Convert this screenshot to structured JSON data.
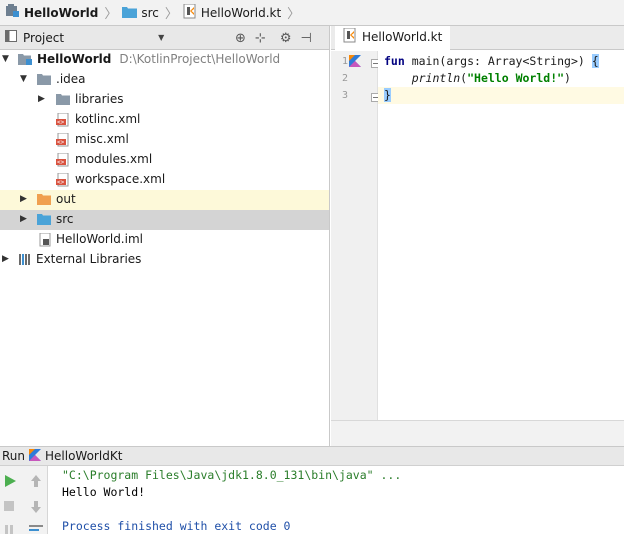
{
  "navbar": {
    "crumbs": [
      {
        "label": "HelloWorld",
        "icon": "project-module-icon"
      },
      {
        "label": "src",
        "icon": "source-folder-icon"
      },
      {
        "label": "HelloWorld.kt",
        "icon": "kotlin-file-icon"
      }
    ]
  },
  "project_pane": {
    "title": "Project",
    "toolbar_icons": [
      "target-icon",
      "collapse-all-icon",
      "gear-icon",
      "hide-panel-icon"
    ],
    "tree": [
      {
        "label": "HelloWorld",
        "path": "D:\\KotlinProject\\HelloWorld",
        "level": 0,
        "expanded": true,
        "icon": "module-folder-icon"
      },
      {
        "label": ".idea",
        "level": 1,
        "expanded": true,
        "icon": "folder-icon"
      },
      {
        "label": "libraries",
        "level": 2,
        "expanded": false,
        "icon": "folder-icon"
      },
      {
        "label": "kotlinc.xml",
        "level": 2,
        "icon": "xml-file-icon"
      },
      {
        "label": "misc.xml",
        "level": 2,
        "icon": "xml-file-icon"
      },
      {
        "label": "modules.xml",
        "level": 2,
        "icon": "xml-file-icon"
      },
      {
        "label": "workspace.xml",
        "level": 2,
        "icon": "xml-file-icon"
      },
      {
        "label": "out",
        "level": 1,
        "expanded": false,
        "icon": "excluded-folder-icon",
        "highlight": "yellow"
      },
      {
        "label": "src",
        "level": 1,
        "expanded": false,
        "icon": "source-folder-icon",
        "highlight": "selected"
      },
      {
        "label": "HelloWorld.iml",
        "level": 1,
        "icon": "iml-file-icon"
      },
      {
        "label": "External Libraries",
        "level": 0,
        "expanded": false,
        "icon": "libraries-icon"
      }
    ]
  },
  "editor": {
    "tab_label": "HelloWorld.kt",
    "line_numbers": [
      "1",
      "2",
      "3"
    ],
    "code": {
      "line1": {
        "kw": "fun",
        "rest": " main(args: Array<String>) ",
        "brace": "{"
      },
      "line2": {
        "indent": "    ",
        "call": "println",
        "open": "(",
        "str": "\"Hello World!\"",
        "close": ")"
      },
      "line3": {
        "brace": "}"
      }
    }
  },
  "run": {
    "label": "Run",
    "config_name": "HelloWorldKt",
    "console": {
      "command": "\"C:\\Program Files\\Java\\jdk1.8.0_131\\bin\\java\" ...",
      "output": "Hello World!",
      "exit": "Process finished with exit code 0"
    }
  },
  "colors": {
    "selection": "#d4d4d4",
    "excluded_highlight": "#fdf9d9",
    "kotlin_orange": "#f88909",
    "run_green": "#4caf50"
  }
}
